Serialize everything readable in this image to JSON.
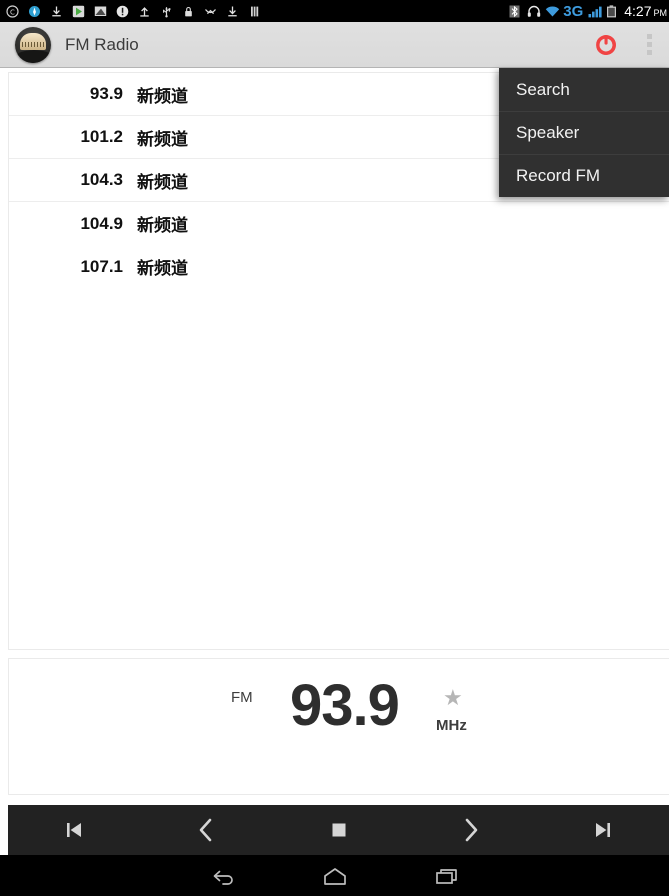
{
  "status_bar": {
    "left_icons": [
      "copyright-circle-icon",
      "compass-icon",
      "download-icon",
      "play-store-icon",
      "screenshot-icon",
      "warning-circle-icon",
      "upload-icon",
      "usb-icon",
      "lock-icon",
      "vpn-icon",
      "download-arrow-icon",
      "sim-bars-icon"
    ],
    "right_icons": [
      "bluetooth-icon",
      "headset-icon",
      "wifi-icon",
      "signal-bars-icon",
      "battery-icon"
    ],
    "network_label": "3G",
    "time": "4:27",
    "ampm": "PM",
    "accent_color": "#3e9bdd"
  },
  "action_bar": {
    "app_icon": "fm-radio-app-icon",
    "title": "FM Radio",
    "power_icon": "power-icon",
    "power_color": "#f04444",
    "overflow_icon": "overflow-menu-icon"
  },
  "overflow_menu": {
    "visible": true,
    "items": [
      {
        "label": "Search",
        "name": "menu-item-search"
      },
      {
        "label": "Speaker",
        "name": "menu-item-speaker"
      },
      {
        "label": "Record FM",
        "name": "menu-item-record-fm"
      }
    ]
  },
  "station_list": [
    {
      "frequency": "93.9",
      "name": "新频道",
      "divider": true
    },
    {
      "frequency": "101.2",
      "name": "新频道",
      "divider": true
    },
    {
      "frequency": "104.3",
      "name": "新频道",
      "divider": true
    },
    {
      "frequency": "104.9",
      "name": "新频道",
      "divider": false
    },
    {
      "frequency": "107.1",
      "name": "新频道",
      "divider": false
    }
  ],
  "frequency_display": {
    "band": "FM",
    "value": "93.9",
    "unit": "MHz",
    "favorite_icon": "star-icon",
    "favorite_active": false,
    "star_glyph": "★"
  },
  "controls": [
    {
      "name": "skip-previous-button",
      "icon": "skip-previous-icon"
    },
    {
      "name": "tune-down-button",
      "icon": "chevron-left-icon"
    },
    {
      "name": "stop-button",
      "icon": "stop-icon"
    },
    {
      "name": "tune-up-button",
      "icon": "chevron-right-icon"
    },
    {
      "name": "skip-next-button",
      "icon": "skip-next-icon"
    }
  ],
  "nav_bar": [
    {
      "name": "nav-back-button",
      "icon": "back-icon"
    },
    {
      "name": "nav-home-button",
      "icon": "home-icon"
    },
    {
      "name": "nav-recents-button",
      "icon": "recents-icon"
    }
  ]
}
